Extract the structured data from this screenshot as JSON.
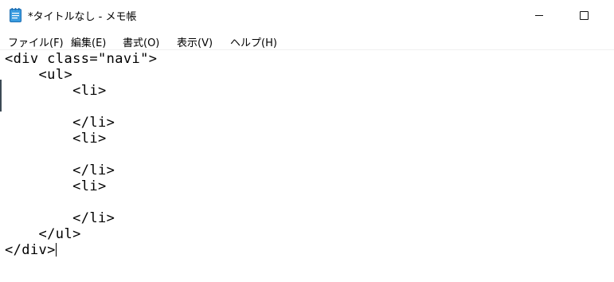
{
  "window": {
    "title": "*タイトルなし - メモ帳",
    "icon": "notepad-icon"
  },
  "menu": [
    {
      "label": "ファイル(F)"
    },
    {
      "label": "編集(E)"
    },
    {
      "label": "書式(O)"
    },
    {
      "label": "表示(V)"
    },
    {
      "label": "ヘルプ(H)"
    }
  ],
  "editor": {
    "lines": [
      "<div class=\"navi\">",
      "    <ul>",
      "        <li>",
      "",
      "        </li>",
      "        <li>",
      "",
      "        </li>",
      "        <li>",
      "",
      "        </li>",
      "    </ul>",
      "</div>"
    ]
  },
  "colors": {
    "icon_blue": "#2f8fd8",
    "background": "#ffffff",
    "text": "#000000"
  }
}
